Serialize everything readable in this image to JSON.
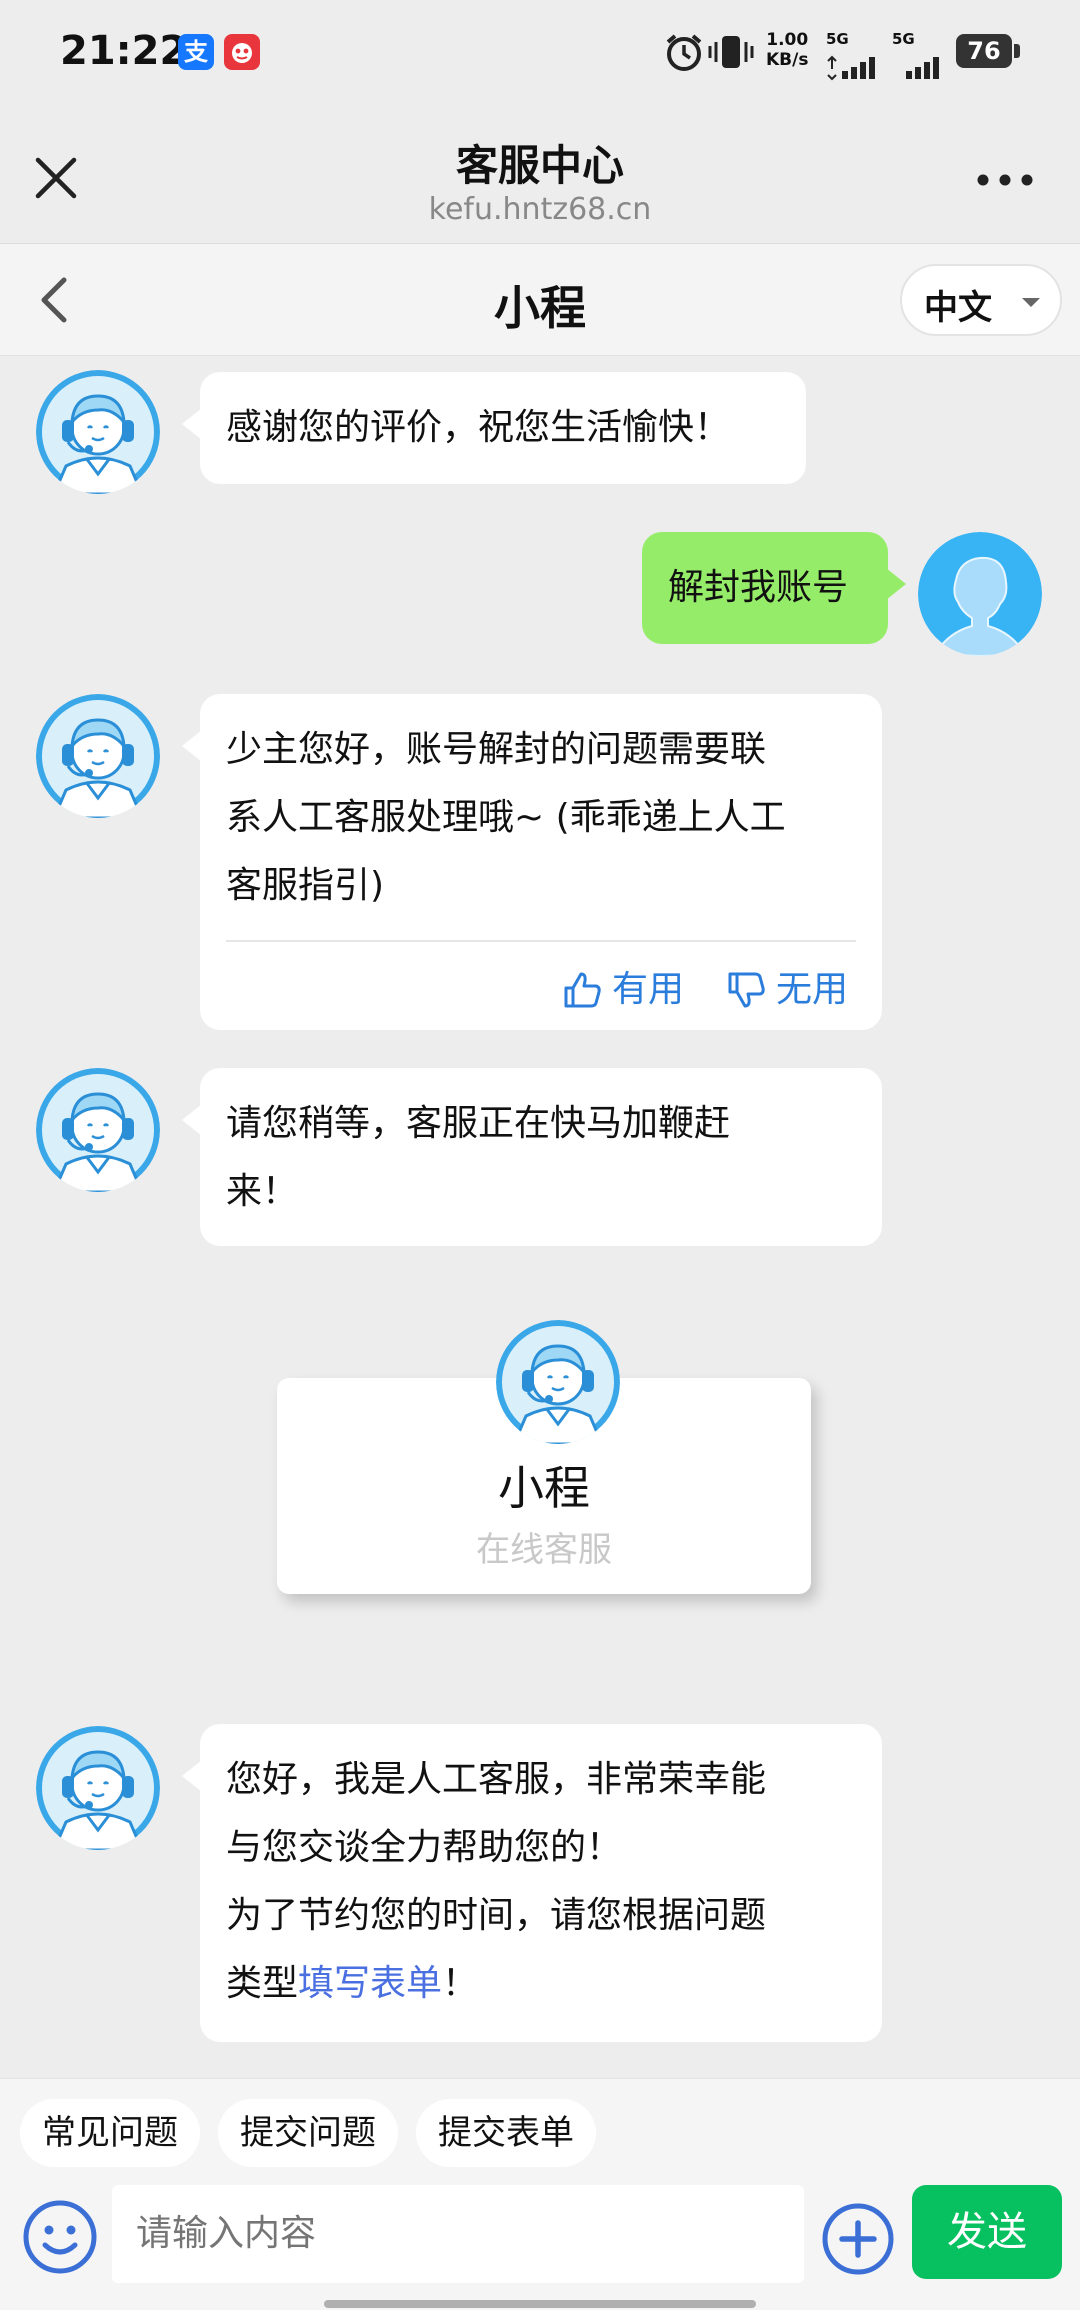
{
  "status_bar": {
    "time": "21:22",
    "alipay_icon": "支",
    "net_speed_value": "1.00",
    "net_speed_unit": "KB/s",
    "sim1": "5G",
    "sim2": "5G",
    "battery": "76"
  },
  "title_bar": {
    "title": "客服中心",
    "url": "kefu.hntz68.cn"
  },
  "chat_header": {
    "agent_name": "小程",
    "language": "中文"
  },
  "messages": [
    {
      "from": "agent",
      "text": "感谢您的评价，祝您生活愉快！"
    },
    {
      "from": "user",
      "text": "解封我账号"
    },
    {
      "from": "agent",
      "lines": [
        "少主您好，账号解封的问题需要联",
        "系人工客服处理哦~ (乖乖递上人工",
        "客服指引)"
      ],
      "feedback": {
        "useful": "有用",
        "useless": "无用"
      }
    },
    {
      "from": "agent",
      "lines": [
        "请您稍等，客服正在快马加鞭赶",
        "来！"
      ]
    },
    {
      "from": "agent",
      "lines": [
        "您好，我是人工客服，非常荣幸能",
        "与您交谈全力帮助您的！",
        "为了节约您的时间，请您根据问题"
      ],
      "last_prefix": "类型",
      "link": "填写表单",
      "last_suffix": "！"
    }
  ],
  "agent_card": {
    "name": "小程",
    "status": "在线客服"
  },
  "quick_replies": [
    "常见问题",
    "提交问题",
    "提交表单"
  ],
  "composer": {
    "placeholder": "请输入内容",
    "send_label": "发送"
  },
  "colors": {
    "send": "#07c160",
    "user_bubble": "#95ec69",
    "link": "#4a6fe0",
    "feedback": "#2b7ddc"
  }
}
